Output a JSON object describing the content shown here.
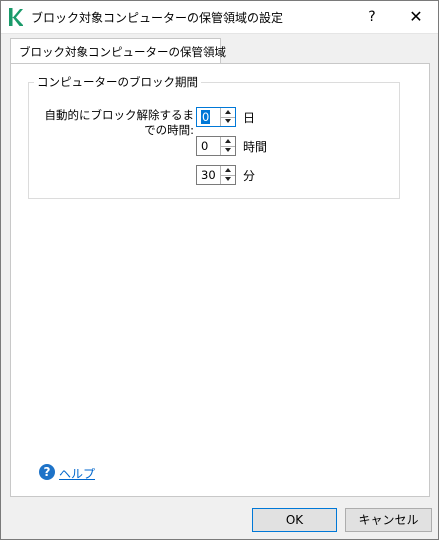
{
  "window": {
    "title": "ブロック対象コンピューターの保管領域の設定",
    "help_glyph": "?",
    "close_glyph": "✕",
    "brand_color": "#1a9a6a"
  },
  "tab": {
    "label": "ブロック対象コンピューターの保管領域"
  },
  "group": {
    "title": "コンピューターのブロック期間",
    "label": "自動的にブロック解除するまでの時間:"
  },
  "fields": [
    {
      "name": "days",
      "value": "0",
      "unit": "日"
    },
    {
      "name": "hours",
      "value": "0",
      "unit": "時間"
    },
    {
      "name": "minutes",
      "value": "30",
      "unit": "分"
    }
  ],
  "help": {
    "icon_glyph": "?",
    "label": "ヘルプ"
  },
  "buttons": {
    "ok": "OK",
    "cancel": "キャンセル"
  }
}
